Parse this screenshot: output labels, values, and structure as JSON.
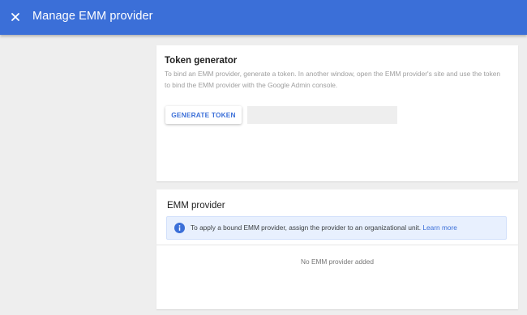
{
  "header": {
    "title": "Manage EMM provider",
    "close_icon": "close-icon",
    "background_color": "#3b6fd8"
  },
  "token_generator": {
    "title": "Token generator",
    "description": "To bind an EMM provider, generate a token. In another window, open the EMM provider's site and use the token to bind the EMM provider with the Google Admin console.",
    "button_label": "GENERATE TOKEN",
    "token_value": ""
  },
  "emm_provider": {
    "title": "EMM provider",
    "info_icon": "info-icon",
    "info_text": "To apply a bound EMM provider, assign the provider to an organizational unit.",
    "info_link": "Learn more",
    "empty_message": "No EMM provider added"
  }
}
